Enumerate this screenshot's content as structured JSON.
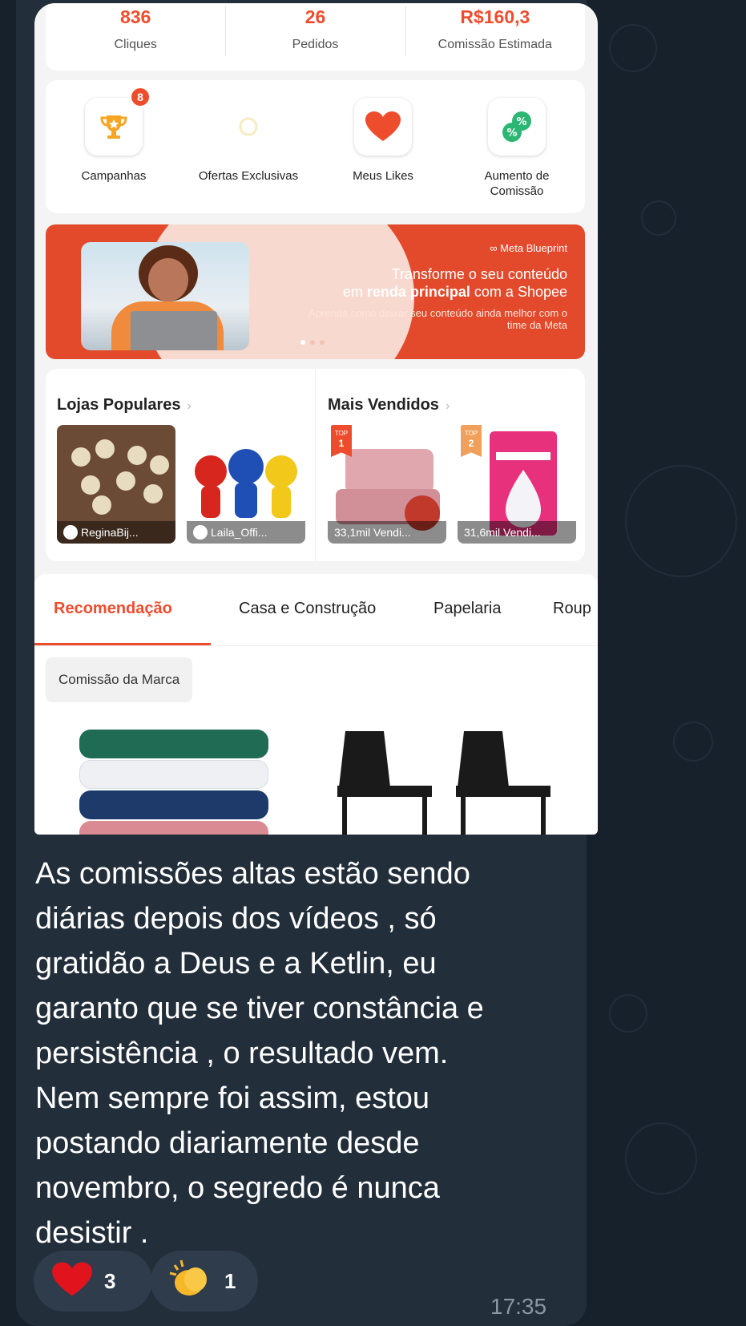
{
  "stats": [
    {
      "value": "836",
      "label": "Cliques"
    },
    {
      "value": "26",
      "label": "Pedidos"
    },
    {
      "value": "R$160,3",
      "label": "Comissão Estimada"
    }
  ],
  "actions": [
    {
      "label": "Campanhas",
      "badge": "8",
      "icon": "trophy-icon"
    },
    {
      "label": "Ofertas Exclusivas",
      "icon": "loading-icon"
    },
    {
      "label": "Meus Likes",
      "icon": "heart-icon"
    },
    {
      "label": "Aumento de\nComissão",
      "icon": "percent-exchange-icon"
    }
  ],
  "banner": {
    "brand": "∞ Meta Blueprint",
    "headline_line1": "Transforme o seu conteúdo",
    "headline_pre": "em ",
    "headline_bold": "renda principal",
    "headline_post": " com a Shopee",
    "sub": "Aprenda como deixar seu conteúdo ainda melhor com o time da Meta"
  },
  "popular_shops": {
    "title": "Lojas Populares",
    "items": [
      {
        "caption": "ReginaBij..."
      },
      {
        "caption": "Laila_Offi..."
      }
    ]
  },
  "best_sellers": {
    "title": "Mais Vendidos",
    "items": [
      {
        "rank_label": "TOP",
        "rank": "1",
        "caption": "33,1mil Vendi..."
      },
      {
        "rank_label": "TOP",
        "rank": "2",
        "caption": "31,6mil Vendi..."
      }
    ]
  },
  "category_tabs": [
    {
      "label": "Recomendação",
      "active": true
    },
    {
      "label": "Casa e Construção"
    },
    {
      "label": "Papelaria"
    },
    {
      "label": "Roup"
    }
  ],
  "filter_chip": "Comissão da Marca",
  "message": {
    "text": "As comissões altas  estão sendo\ndiárias depois dos vídeos , só\ngratidão a Deus e a Ketlin, eu\ngaranto que se tiver constância e\npersistência , o resultado vem.\nNem sempre foi assim, estou\npostando diariamente desde\nnovembro, o segredo é nunca\ndesistir .",
    "time": "17:35"
  },
  "reactions": [
    {
      "emoji": "red-heart-icon",
      "count": "3"
    },
    {
      "emoji": "clapping-hands-icon",
      "count": "1"
    }
  ],
  "colors": {
    "accent": "#ee4d2d",
    "chat_background": "#17212b",
    "bubble": "#222e3a"
  }
}
